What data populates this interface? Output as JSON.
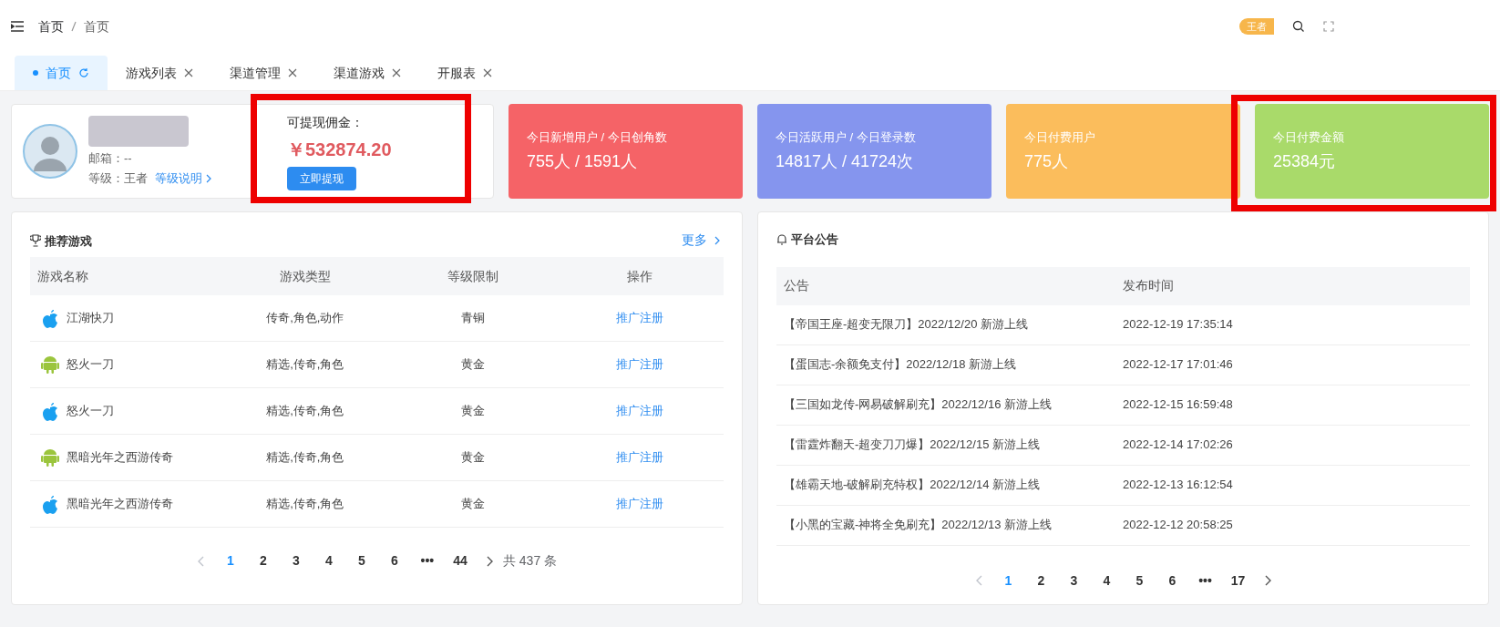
{
  "breadcrumb": [
    "首页",
    "首页"
  ],
  "header": {
    "badge": "王者"
  },
  "tabs": [
    {
      "label": "首页",
      "selected": true,
      "closable": false
    },
    {
      "label": "游戏列表",
      "selected": false,
      "closable": true
    },
    {
      "label": "渠道管理",
      "selected": false,
      "closable": true
    },
    {
      "label": "渠道游戏",
      "selected": false,
      "closable": true
    },
    {
      "label": "开服表",
      "selected": false,
      "closable": true
    }
  ],
  "profile": {
    "email": "邮箱：--",
    "level_label": "等级：王者",
    "level_link": "等级说明"
  },
  "withdraw": {
    "label": "可提现佣金：",
    "amount": "￥532874.20",
    "button": "立即提现",
    "highlighted": true
  },
  "stats": [
    {
      "label": "今日新增用户 / 今日创角数",
      "value": "755人 / 1591人",
      "color": "#f56367",
      "highlighted": false
    },
    {
      "label": "今日活跃用户 / 今日登录数",
      "value": "14817人 / 41724次",
      "color": "#8595ee",
      "highlighted": false
    },
    {
      "label": "今日付费用户",
      "value": "775人",
      "color": "#fbbd5c",
      "highlighted": false
    },
    {
      "label": "今日付费金额",
      "value": "25384元",
      "color": "#a9da6a",
      "highlighted": true
    }
  ],
  "games": {
    "title": "推荐游戏",
    "more": "更多",
    "columns": [
      "游戏名称",
      "游戏类型",
      "等级限制",
      "操作"
    ],
    "rows": [
      {
        "kind": "ios",
        "name": "江湖快刀",
        "type": "传奇,角色,动作",
        "level": "青铜",
        "action": "推广注册"
      },
      {
        "kind": "android",
        "name": "怒火一刀",
        "type": "精选,传奇,角色",
        "level": "黄金",
        "action": "推广注册"
      },
      {
        "kind": "ios",
        "name": "怒火一刀",
        "type": "精选,传奇,角色",
        "level": "黄金",
        "action": "推广注册"
      },
      {
        "kind": "android",
        "name": "黑暗光年之西游传奇",
        "type": "精选,传奇,角色",
        "level": "黄金",
        "action": "推广注册"
      },
      {
        "kind": "ios",
        "name": "黑暗光年之西游传奇",
        "type": "精选,传奇,角色",
        "level": "黄金",
        "action": "推广注册"
      }
    ],
    "pagination": {
      "pages": [
        {
          "label": "1",
          "selected": true
        },
        {
          "label": "2",
          "selected": false
        },
        {
          "label": "3",
          "selected": false
        },
        {
          "label": "4",
          "selected": false
        },
        {
          "label": "5",
          "selected": false
        },
        {
          "label": "6",
          "selected": false
        },
        {
          "label": "•••",
          "selected": false
        },
        {
          "label": "44",
          "selected": false
        }
      ],
      "total": "共 437 条"
    }
  },
  "notices": {
    "title": "平台公告",
    "columns": [
      "公告",
      "发布时间"
    ],
    "rows": [
      {
        "text": "【帝国王座-超变无限刀】2022/12/20 新游上线",
        "time": "2022-12-19 17:35:14"
      },
      {
        "text": "【蛋国志-余额免支付】2022/12/18 新游上线",
        "time": "2022-12-17 17:01:46"
      },
      {
        "text": "【三国如龙传-网易破解刷充】2022/12/16 新游上线",
        "time": "2022-12-15 16:59:48"
      },
      {
        "text": "【雷霆炸翻天-超变刀刀爆】2022/12/15 新游上线",
        "time": "2022-12-14 17:02:26"
      },
      {
        "text": "【雄霸天地-破解刷充特权】2022/12/14 新游上线",
        "time": "2022-12-13 16:12:54"
      },
      {
        "text": "【小黑的宝藏-神将全免刷充】2022/12/13 新游上线",
        "time": "2022-12-12 20:58:25"
      }
    ],
    "pagination": {
      "pages": [
        {
          "label": "1",
          "selected": true
        },
        {
          "label": "2",
          "selected": false
        },
        {
          "label": "3",
          "selected": false
        },
        {
          "label": "4",
          "selected": false
        },
        {
          "label": "5",
          "selected": false
        },
        {
          "label": "6",
          "selected": false
        },
        {
          "label": "•••",
          "selected": false
        },
        {
          "label": "17",
          "selected": false
        }
      ]
    }
  }
}
